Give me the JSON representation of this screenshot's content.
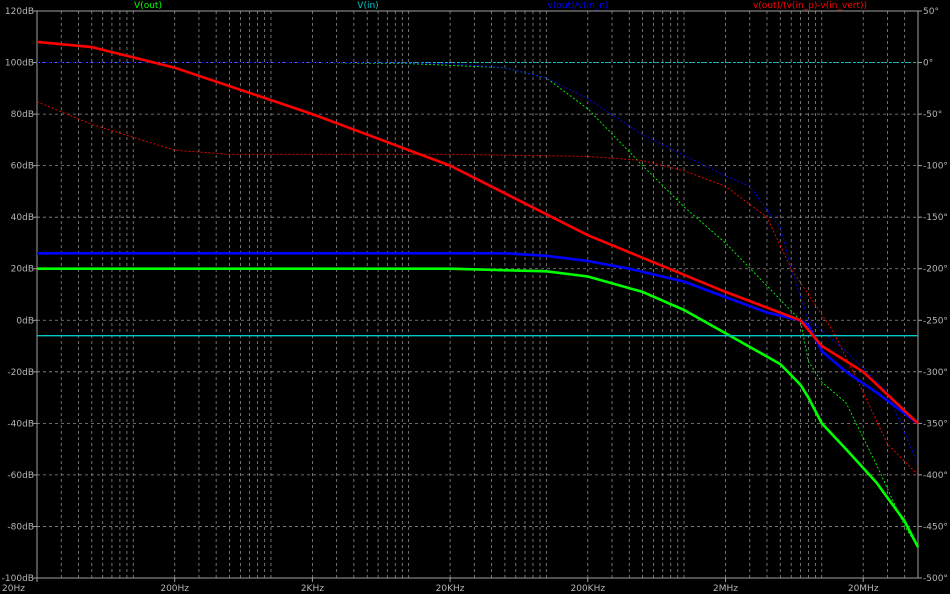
{
  "chart_data": {
    "type": "line",
    "title": "",
    "x_scale": "log",
    "xlim": [
      20,
      50000000
    ],
    "ylim_left": [
      -100,
      120
    ],
    "ylim_right": [
      -500,
      50
    ],
    "grid": true,
    "x_ticks": [
      {
        "value": 20,
        "label": "20Hz"
      },
      {
        "value": 200,
        "label": "200Hz"
      },
      {
        "value": 2000,
        "label": "2KHz"
      },
      {
        "value": 20000,
        "label": "20KHz"
      },
      {
        "value": 200000,
        "label": "200KHz"
      },
      {
        "value": 2000000,
        "label": "2MHz"
      },
      {
        "value": 20000000,
        "label": "20MHz"
      }
    ],
    "y_ticks_left": [
      {
        "value": 120,
        "label": "120dB"
      },
      {
        "value": 100,
        "label": "100dB"
      },
      {
        "value": 80,
        "label": "80dB"
      },
      {
        "value": 60,
        "label": "60dB"
      },
      {
        "value": 40,
        "label": "40dB"
      },
      {
        "value": 20,
        "label": "20dB"
      },
      {
        "value": 0,
        "label": "0dB"
      },
      {
        "value": -20,
        "label": "-20dB"
      },
      {
        "value": -40,
        "label": "-40dB"
      },
      {
        "value": -60,
        "label": "-60dB"
      },
      {
        "value": -80,
        "label": "-80dB"
      },
      {
        "value": -100,
        "label": "-100dB"
      }
    ],
    "y_ticks_right": [
      {
        "value": 50,
        "label": "50°"
      },
      {
        "value": 0,
        "label": "0°"
      },
      {
        "value": -50,
        "label": "-50°"
      },
      {
        "value": -100,
        "label": "-100°"
      },
      {
        "value": -150,
        "label": "-150°"
      },
      {
        "value": -200,
        "label": "-200°"
      },
      {
        "value": -250,
        "label": "-250°"
      },
      {
        "value": -300,
        "label": "-300°"
      },
      {
        "value": -350,
        "label": "-350°"
      },
      {
        "value": -400,
        "label": "-400°"
      },
      {
        "value": -450,
        "label": "-450°"
      },
      {
        "value": -500,
        "label": "-500°"
      }
    ],
    "series": [
      {
        "name": "V(out)",
        "color": "#00ff00",
        "magnitude": [
          [
            20,
            20
          ],
          [
            2000,
            20
          ],
          [
            20000,
            20
          ],
          [
            100000,
            19
          ],
          [
            200000,
            17
          ],
          [
            500000,
            11
          ],
          [
            1000000,
            4
          ],
          [
            2000000,
            -5
          ],
          [
            5000000,
            -17
          ],
          [
            7000000,
            -25
          ],
          [
            8000000,
            -30
          ],
          [
            10000000,
            -40
          ],
          [
            15000000,
            -50
          ],
          [
            25000000,
            -63
          ],
          [
            40000000,
            -78
          ],
          [
            50000000,
            -88
          ]
        ],
        "phase": [
          [
            20,
            0
          ],
          [
            2000,
            0
          ],
          [
            10000,
            -1
          ],
          [
            50000,
            -5
          ],
          [
            100000,
            -15
          ],
          [
            200000,
            -45
          ],
          [
            500000,
            -100
          ],
          [
            1000000,
            -140
          ],
          [
            2000000,
            -175
          ],
          [
            5000000,
            -230
          ],
          [
            7000000,
            -250
          ],
          [
            8000000,
            -290
          ],
          [
            10000000,
            -310
          ],
          [
            15000000,
            -330
          ],
          [
            25000000,
            -390
          ],
          [
            40000000,
            -450
          ],
          [
            50000000,
            -470
          ]
        ]
      },
      {
        "name": "V(in)",
        "color": "#00c8c8",
        "magnitude": [
          [
            20,
            -6
          ],
          [
            50000000,
            -6
          ]
        ],
        "phase": [
          [
            20,
            0
          ],
          [
            50000000,
            0
          ]
        ]
      },
      {
        "name": "v(out)/v(in_n)",
        "color": "#0000ff",
        "magnitude": [
          [
            20,
            26
          ],
          [
            2000,
            26
          ],
          [
            50000,
            26
          ],
          [
            100000,
            25
          ],
          [
            200000,
            23
          ],
          [
            400000,
            20
          ],
          [
            1000000,
            15
          ],
          [
            2000000,
            9
          ],
          [
            4000000,
            3
          ],
          [
            7000000,
            0
          ],
          [
            8000000,
            -2
          ],
          [
            10000000,
            -12
          ],
          [
            15000000,
            -20
          ],
          [
            25000000,
            -28
          ],
          [
            50000000,
            -40
          ]
        ],
        "phase": [
          [
            20,
            0
          ],
          [
            5000,
            0
          ],
          [
            20000,
            -1
          ],
          [
            50000,
            -5
          ],
          [
            100000,
            -15
          ],
          [
            200000,
            -35
          ],
          [
            500000,
            -70
          ],
          [
            1000000,
            -90
          ],
          [
            2000000,
            -110
          ],
          [
            3000000,
            -120
          ],
          [
            5000000,
            -160
          ],
          [
            6000000,
            -200
          ],
          [
            8000000,
            -250
          ],
          [
            15000000,
            -280
          ],
          [
            30000000,
            -320
          ],
          [
            50000000,
            -390
          ]
        ]
      },
      {
        "name": "v(out)/(v(in_p)-v(in_vert))",
        "color": "#ff0000",
        "magnitude": [
          [
            20,
            108
          ],
          [
            50,
            106
          ],
          [
            200,
            98
          ],
          [
            2000,
            80
          ],
          [
            20000,
            60
          ],
          [
            200000,
            33
          ],
          [
            2000000,
            11
          ],
          [
            7000000,
            0
          ],
          [
            10000000,
            -10
          ],
          [
            20000000,
            -20
          ],
          [
            50000000,
            -40
          ]
        ],
        "phase": [
          [
            20,
            -38
          ],
          [
            50,
            -60
          ],
          [
            200,
            -85
          ],
          [
            500,
            -89
          ],
          [
            20000,
            -89
          ],
          [
            200000,
            -91
          ],
          [
            500000,
            -95
          ],
          [
            1000000,
            -105
          ],
          [
            2000000,
            -120
          ],
          [
            4000000,
            -150
          ],
          [
            6000000,
            -200
          ],
          [
            8000000,
            -225
          ],
          [
            12000000,
            -260
          ],
          [
            20000000,
            -320
          ],
          [
            30000000,
            -370
          ],
          [
            50000000,
            -400
          ]
        ]
      }
    ]
  }
}
